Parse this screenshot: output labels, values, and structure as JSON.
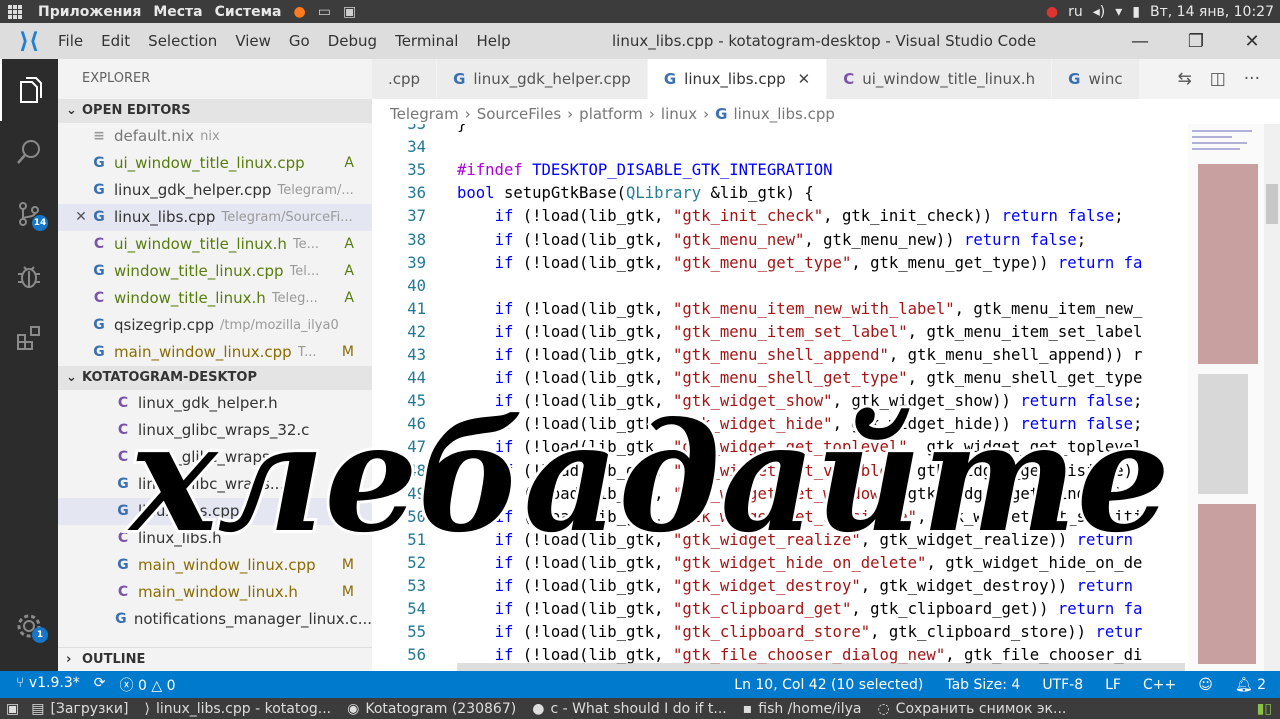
{
  "topbar": {
    "apps": [
      "Приложения",
      "Места",
      "Система"
    ],
    "lang": "ru",
    "clock": "Вт, 14 янв, 10:27"
  },
  "window": {
    "menu": [
      "File",
      "Edit",
      "Selection",
      "View",
      "Go",
      "Debug",
      "Terminal",
      "Help"
    ],
    "title": "linux_libs.cpp - kotatogram-desktop - Visual Studio Code"
  },
  "activity": {
    "scm_badge": "14",
    "settings_badge": "1"
  },
  "explorer": {
    "title": "EXPLORER",
    "open_editors_label": "OPEN EDITORS",
    "open_editors": [
      {
        "icon": "≡",
        "name": "default.nix",
        "desc": "nix",
        "status": ""
      },
      {
        "icon": "G",
        "name": "ui_window_title_linux.cpp",
        "desc": "",
        "status": "A"
      },
      {
        "icon": "G",
        "name": "linux_gdk_helper.cpp",
        "desc": "Telegram/...",
        "status": ""
      },
      {
        "icon": "G",
        "name": "linux_libs.cpp",
        "desc": "Telegram/SourceFi...",
        "status": ""
      },
      {
        "icon": "C",
        "name": "ui_window_title_linux.h",
        "desc": "Te...",
        "status": "A"
      },
      {
        "icon": "G",
        "name": "window_title_linux.cpp",
        "desc": "Tel...",
        "status": "A"
      },
      {
        "icon": "C",
        "name": "window_title_linux.h",
        "desc": "Teleg...",
        "status": "A"
      },
      {
        "icon": "G",
        "name": "qsizegrip.cpp",
        "desc": "/tmp/mozilla_ilya0",
        "status": ""
      },
      {
        "icon": "G",
        "name": "main_window_linux.cpp",
        "desc": "T...",
        "status": "M"
      }
    ],
    "project_label": "KOTATOGRAM-DESKTOP",
    "project_files": [
      {
        "icon": "C",
        "name": "linux_gdk_helper.h",
        "status": ""
      },
      {
        "icon": "C",
        "name": "linux_glibc_wraps_32.c",
        "status": ""
      },
      {
        "icon": "C",
        "name": "linux_glibc_wraps_...",
        "status": ""
      },
      {
        "icon": "G",
        "name": "linux_glibc_wraps...",
        "status": ""
      },
      {
        "icon": "G",
        "name": "linux_libs.cpp",
        "status": ""
      },
      {
        "icon": "C",
        "name": "linux_libs.h",
        "status": ""
      },
      {
        "icon": "G",
        "name": "main_window_linux.cpp",
        "status": "M"
      },
      {
        "icon": "C",
        "name": "main_window_linux.h",
        "status": "M"
      },
      {
        "icon": "G",
        "name": "notifications_manager_linux.c...",
        "status": ""
      }
    ],
    "outline_label": "OUTLINE"
  },
  "tabs": [
    {
      "icon": "",
      "name": ".cpp",
      "active": false
    },
    {
      "icon": "G",
      "name": "linux_gdk_helper.cpp",
      "active": false
    },
    {
      "icon": "G",
      "name": "linux_libs.cpp",
      "active": true
    },
    {
      "icon": "C",
      "name": "ui_window_title_linux.h",
      "active": false
    },
    {
      "icon": "G",
      "name": "winc",
      "active": false
    }
  ],
  "breadcrumb": [
    "Telegram",
    "SourceFiles",
    "platform",
    "linux",
    "linux_libs.cpp"
  ],
  "code": {
    "first_line": 33,
    "lines": [
      [
        [
          "",
          "}"
        ]
      ],
      [],
      [
        [
          "pp",
          "#ifndef"
        ],
        [
          "",
          " "
        ],
        [
          "mac",
          "TDESKTOP_DISABLE_GTK_INTEGRATION"
        ]
      ],
      [
        [
          "kw",
          "bool"
        ],
        [
          "",
          " setupGtkBase("
        ],
        [
          "typ",
          "QLibrary"
        ],
        [
          "",
          " &lib_gtk) {"
        ]
      ],
      [
        [
          "",
          "    "
        ],
        [
          "kw",
          "if"
        ],
        [
          "",
          " (!load(lib_gtk, "
        ],
        [
          "str",
          "\"gtk_init_check\""
        ],
        [
          "",
          ", gtk_init_check)) "
        ],
        [
          "kw",
          "return"
        ],
        [
          "",
          " "
        ],
        [
          "kw",
          "false"
        ],
        [
          "",
          ";"
        ]
      ],
      [
        [
          "",
          "    "
        ],
        [
          "kw",
          "if"
        ],
        [
          "",
          " (!load(lib_gtk, "
        ],
        [
          "str",
          "\"gtk_menu_new\""
        ],
        [
          "",
          ", gtk_menu_new)) "
        ],
        [
          "kw",
          "return"
        ],
        [
          "",
          " "
        ],
        [
          "kw",
          "false"
        ],
        [
          "",
          ";"
        ]
      ],
      [
        [
          "",
          "    "
        ],
        [
          "kw",
          "if"
        ],
        [
          "",
          " (!load(lib_gtk, "
        ],
        [
          "str",
          "\"gtk_menu_get_type\""
        ],
        [
          "",
          ", gtk_menu_get_type)) "
        ],
        [
          "kw",
          "return"
        ],
        [
          "",
          " "
        ],
        [
          "kw",
          "fa"
        ]
      ],
      [],
      [
        [
          "",
          "    "
        ],
        [
          "kw",
          "if"
        ],
        [
          "",
          " (!load(lib_gtk, "
        ],
        [
          "str",
          "\"gtk_menu_item_new_with_label\""
        ],
        [
          "",
          ", gtk_menu_item_new_"
        ]
      ],
      [
        [
          "",
          "    "
        ],
        [
          "kw",
          "if"
        ],
        [
          "",
          " (!load(lib_gtk, "
        ],
        [
          "str",
          "\"gtk_menu_item_set_label\""
        ],
        [
          "",
          ", gtk_menu_item_set_label"
        ]
      ],
      [
        [
          "",
          "    "
        ],
        [
          "kw",
          "if"
        ],
        [
          "",
          " (!load(lib_gtk, "
        ],
        [
          "str",
          "\"gtk_menu_shell_append\""
        ],
        [
          "",
          ", gtk_menu_shell_append)) r"
        ]
      ],
      [
        [
          "",
          "    "
        ],
        [
          "kw",
          "if"
        ],
        [
          "",
          " (!load(lib_gtk, "
        ],
        [
          "str",
          "\"gtk_menu_shell_get_type\""
        ],
        [
          "",
          ", gtk_menu_shell_get_type"
        ]
      ],
      [
        [
          "",
          "    "
        ],
        [
          "kw",
          "if"
        ],
        [
          "",
          " (!load(lib_gtk, "
        ],
        [
          "str",
          "\"gtk_widget_show\""
        ],
        [
          "",
          ", gtk_widget_show)) "
        ],
        [
          "kw",
          "return"
        ],
        [
          "",
          " "
        ],
        [
          "kw",
          "false"
        ],
        [
          "",
          ";"
        ]
      ],
      [
        [
          "",
          "    "
        ],
        [
          "kw",
          "if"
        ],
        [
          "",
          " (!load(lib_gtk, "
        ],
        [
          "str",
          "\"gtk_widget_hide\""
        ],
        [
          "",
          ", gtk_widget_hide)) "
        ],
        [
          "kw",
          "return"
        ],
        [
          "",
          " "
        ],
        [
          "kw",
          "false"
        ],
        [
          "",
          ";"
        ]
      ],
      [
        [
          "",
          "    "
        ],
        [
          "kw",
          "if"
        ],
        [
          "",
          " (!load(lib_gtk, "
        ],
        [
          "str",
          "\"gtk_widget_get_toplevel\""
        ],
        [
          "",
          ", gtk_widget_get_toplevel"
        ]
      ],
      [
        [
          "",
          "    "
        ],
        [
          "kw",
          "if"
        ],
        [
          "",
          " (!load(lib_gtk, "
        ],
        [
          "str",
          "\"gtk_widget_get_visible\""
        ],
        [
          "",
          ", gtk_widget_get_visible))"
        ]
      ],
      [
        [
          "",
          "    "
        ],
        [
          "kw",
          "if"
        ],
        [
          "",
          " (!load(lib_gtk, "
        ],
        [
          "str",
          "\"gtk_widget_get_window\""
        ],
        [
          "",
          ", gtk_widget_get_window)) r"
        ]
      ],
      [
        [
          "",
          "    "
        ],
        [
          "kw",
          "if"
        ],
        [
          "",
          " (!load(lib_gtk, "
        ],
        [
          "str",
          "\"gtk_widget_set_sensitive\""
        ],
        [
          "",
          ", gtk_widget_set_sensiti"
        ]
      ],
      [
        [
          "",
          "    "
        ],
        [
          "kw",
          "if"
        ],
        [
          "",
          " (!load(lib_gtk, "
        ],
        [
          "str",
          "\"gtk_widget_realize\""
        ],
        [
          "",
          ", gtk_widget_realize)) "
        ],
        [
          "kw",
          "return"
        ]
      ],
      [
        [
          "",
          "    "
        ],
        [
          "kw",
          "if"
        ],
        [
          "",
          " (!load(lib_gtk, "
        ],
        [
          "str",
          "\"gtk_widget_hide_on_delete\""
        ],
        [
          "",
          ", gtk_widget_hide_on_de"
        ]
      ],
      [
        [
          "",
          "    "
        ],
        [
          "kw",
          "if"
        ],
        [
          "",
          " (!load(lib_gtk, "
        ],
        [
          "str",
          "\"gtk_widget_destroy\""
        ],
        [
          "",
          ", gtk_widget_destroy)) "
        ],
        [
          "kw",
          "return"
        ]
      ],
      [
        [
          "",
          "    "
        ],
        [
          "kw",
          "if"
        ],
        [
          "",
          " (!load(lib_gtk, "
        ],
        [
          "str",
          "\"gtk_clipboard_get\""
        ],
        [
          "",
          ", gtk_clipboard_get)) "
        ],
        [
          "kw",
          "return"
        ],
        [
          "",
          " "
        ],
        [
          "kw",
          "fa"
        ]
      ],
      [
        [
          "",
          "    "
        ],
        [
          "kw",
          "if"
        ],
        [
          "",
          " (!load(lib_gtk, "
        ],
        [
          "str",
          "\"gtk_clipboard_store\""
        ],
        [
          "",
          ", gtk_clipboard_store)) "
        ],
        [
          "kw",
          "retur"
        ]
      ],
      [
        [
          "",
          "    "
        ],
        [
          "kw",
          "if"
        ],
        [
          "",
          " (!load(lib_gtk, "
        ],
        [
          "str",
          "\"gtk_file_chooser_dialog_new\""
        ],
        [
          "",
          ", gtk_file_chooser_di"
        ]
      ]
    ]
  },
  "overlay_text": "хлебадайте",
  "status": {
    "branch": "v1.9.3*",
    "errors": "0",
    "warnings": "0",
    "cursor": "Ln 10, Col 42 (10 selected)",
    "tab_size": "Tab Size: 4",
    "encoding": "UTF-8",
    "eol": "LF",
    "language": "C++",
    "notifications": "2"
  },
  "taskbar": [
    {
      "label": "[Загрузки]"
    },
    {
      "label": "linux_libs.cpp - kotatog..."
    },
    {
      "label": "Kotatogram (230867)"
    },
    {
      "label": "c - What should I do if t..."
    },
    {
      "label": "fish /home/ilya"
    },
    {
      "label": "Сохранить снимок эк..."
    }
  ],
  "colors": {
    "accent": "#007acc",
    "keyword": "#0000ff",
    "string": "#a31515",
    "preprocessor": "#af00db"
  }
}
